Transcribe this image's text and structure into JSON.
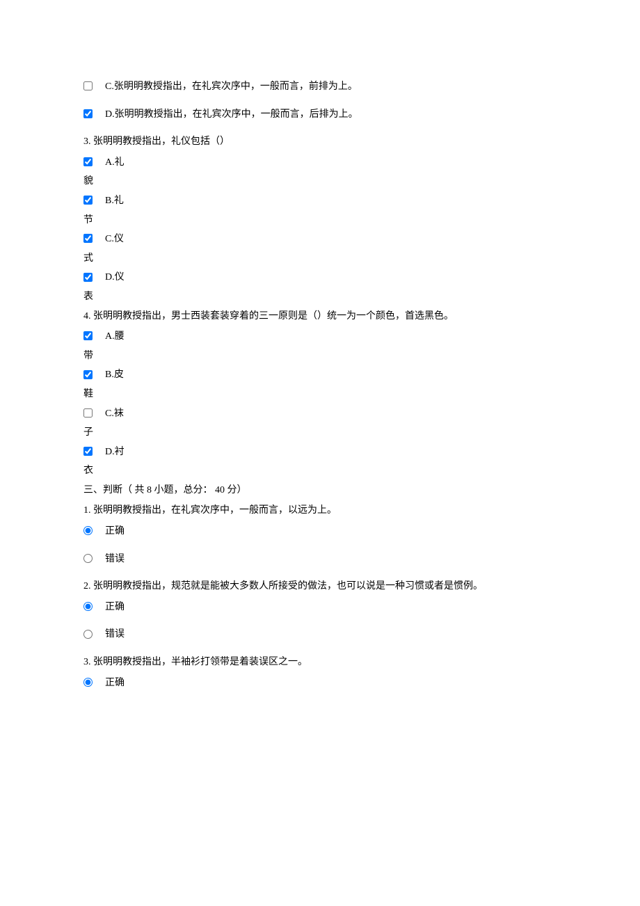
{
  "q_prev": {
    "c": "C.张明明教授指出，在礼宾次序中，一般而言，前排为上。",
    "d": "D.张明明教授指出，在礼宾次序中，一般而言，后排为上。"
  },
  "q3": {
    "head": "3. 张明明教授指出，礼仪包括（）",
    "a_label": "A.礼",
    "a_wrap": "貌",
    "b_label": "B.礼",
    "b_wrap": "节",
    "c_label": "C.仪",
    "c_wrap": "式",
    "d_label": "D.仪",
    "d_wrap": "表"
  },
  "q4": {
    "head": "4. 张明明教授指出，男士西装套装穿着的三一原则是（）统一为一个颜色，首选黑色。",
    "a_label": "A.腰",
    "a_wrap": "带",
    "b_label": "B.皮",
    "b_wrap": "鞋",
    "c_label": "C.袜",
    "c_wrap": "子",
    "d_label": "D.衬",
    "d_wrap": "衣"
  },
  "section3": "三、判断（ 共 8 小题，总分： 40 分）",
  "tf": {
    "correct": "正确",
    "wrong": "错误"
  },
  "tf1": "1. 张明明教授指出，在礼宾次序中，一般而言，以远为上。",
  "tf2": "2. 张明明教授指出，规范就是能被大多数人所接受的做法，也可以说是一种习惯或者是惯例。",
  "tf3": "3. 张明明教授指出，半袖衫打领带是着装误区之一。"
}
